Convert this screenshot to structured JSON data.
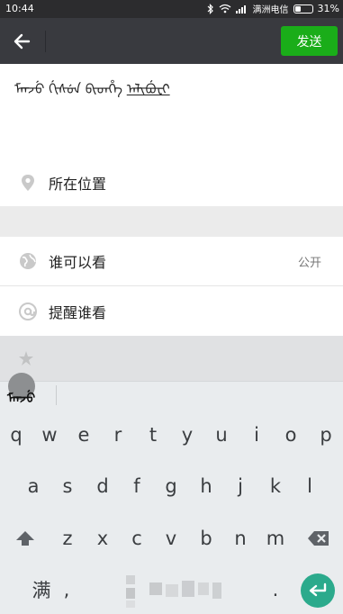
{
  "status_bar": {
    "time": "10:44",
    "carrier": "满洲电信",
    "battery": "31%"
  },
  "nav": {
    "send_label": "发送"
  },
  "compose": {
    "text_part1": "ᠮᠠᠨᠵᡠ ᡤᡳᠰᡠᠨ ᠪᡳᡨᡥᡝ",
    "text_part2": "ᠠᠯᡳᠪᡠᡶᡳ"
  },
  "options": {
    "location_label": "所在位置",
    "privacy_label": "谁可以看",
    "privacy_value": "公开",
    "remind_label": "提醒谁看"
  },
  "candidate": {
    "text": "ᠮᠠᠨᠵᡠ"
  },
  "keyboard": {
    "row1": [
      "q",
      "w",
      "e",
      "r",
      "t",
      "y",
      "u",
      "i",
      "o",
      "p"
    ],
    "row2": [
      "a",
      "s",
      "d",
      "f",
      "g",
      "h",
      "j",
      "k",
      "l"
    ],
    "row3": [
      "z",
      "x",
      "c",
      "v",
      "b",
      "n",
      "m"
    ],
    "lang_key": "满",
    "comma_key": ",",
    "period_key": "."
  },
  "colors": {
    "nav_bg": "#393a3f",
    "send_bg": "#1aad19",
    "enter_bg": "#2baa8c"
  }
}
